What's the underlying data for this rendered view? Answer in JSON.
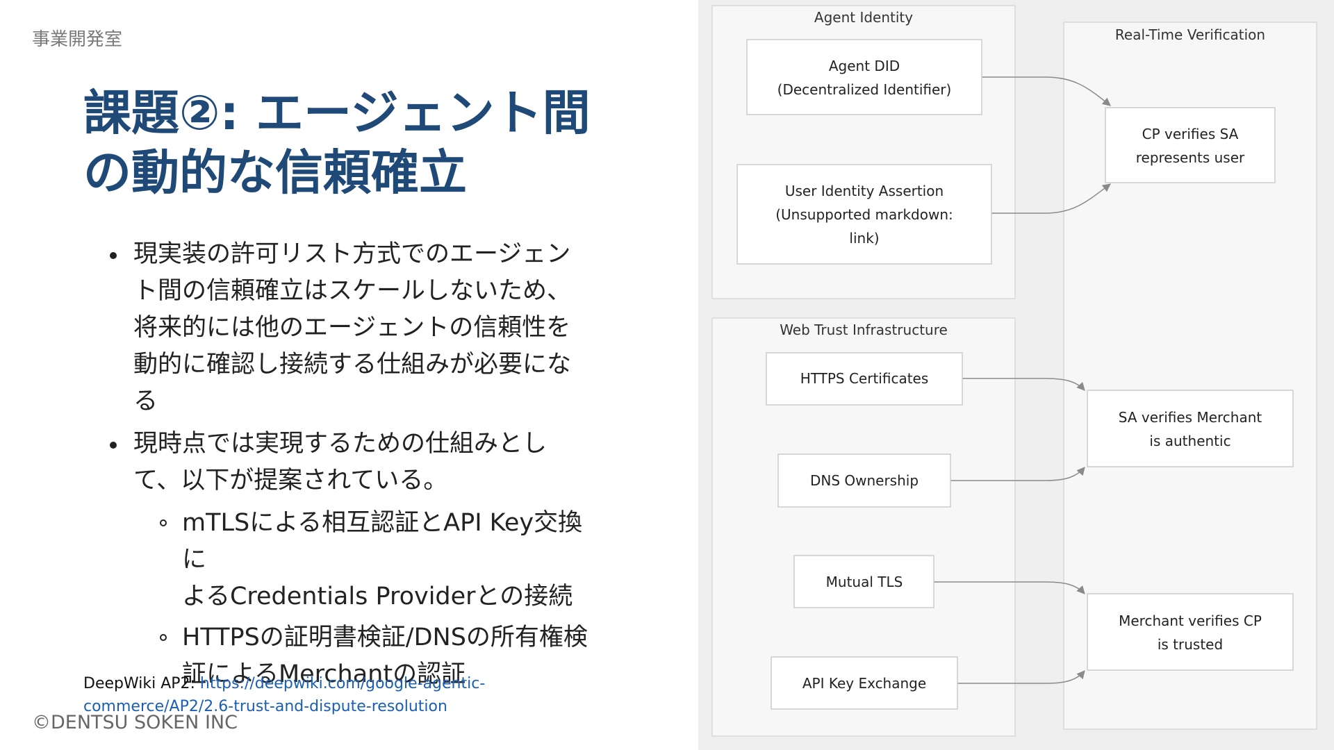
{
  "slide": {
    "department": "事業開発室",
    "title_line1": "課題②: エージェント間",
    "title_line2": "の動的な信頼確立",
    "bullets": [
      {
        "lines": [
          "現実装の許可リスト方式でのエージェン",
          "ト間の信頼確立はスケールしないため、",
          "将来的には他のエージェントの信頼性を",
          "動的に確認し接続する仕組みが必要にな",
          "る"
        ]
      },
      {
        "lines": [
          "現時点では実現するための仕組みとし",
          "て、以下が提案されている。"
        ]
      }
    ],
    "sub_bullets": [
      {
        "lines": [
          "mTLSによる相互認証とAPI Key交換に",
          "よるCredentials Providerとの接続"
        ]
      },
      {
        "lines": [
          "HTTPSの証明書検証/DNSの所有権検",
          "証によるMerchantの認証"
        ]
      }
    ],
    "reference_prefix": "DeepWiki AP2: ",
    "reference_link_line1": "https://deepwiki.com/google-agentic-",
    "reference_link_line2": "commerce/AP2/2.6-trust-and-dispute-resolution",
    "copyright": "©DENTSU SOKEN INC"
  },
  "diagram": {
    "clusters": {
      "agent_identity": "Agent Identity",
      "web_trust": "Web Trust Infrastructure",
      "verification": "Real-Time Verification"
    },
    "nodes": {
      "agent_did": [
        "Agent DID",
        "(Decentralized Identifier)"
      ],
      "user_assertion": [
        "User Identity Assertion",
        "(Unsupported markdown:",
        "link)"
      ],
      "https_certs": [
        "HTTPS Certificates"
      ],
      "dns_ownership": [
        "DNS Ownership"
      ],
      "mutual_tls": [
        "Mutual TLS"
      ],
      "api_key": [
        "API Key Exchange"
      ],
      "cp_verifies": [
        "CP verifies SA",
        "represents user"
      ],
      "sa_verifies": [
        "SA verifies Merchant",
        "is authentic"
      ],
      "merchant_verifies": [
        "Merchant verifies CP",
        "is trusted"
      ]
    },
    "colors": {
      "cluster_fill": "#f7f7f7",
      "cluster_stroke": "#d9d9d9",
      "node_fill": "#ffffff",
      "node_stroke": "#cccccc",
      "edge": "#8a8a8a"
    }
  }
}
